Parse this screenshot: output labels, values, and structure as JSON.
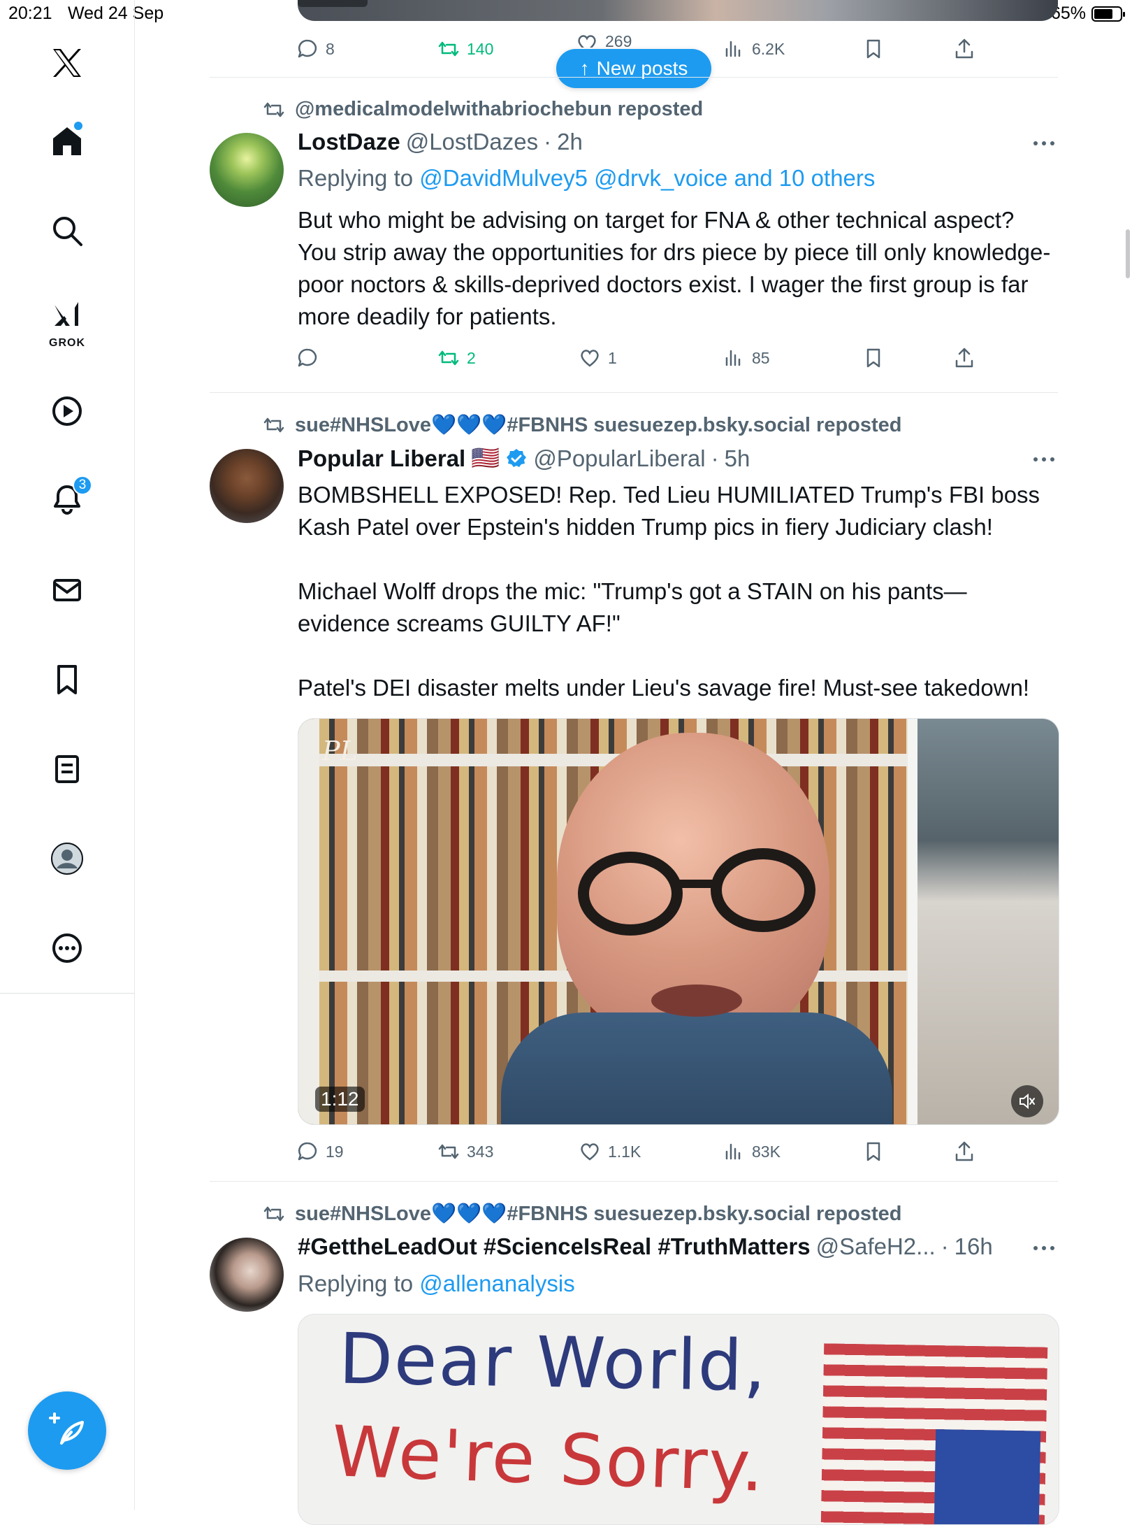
{
  "status_bar": {
    "time": "20:21",
    "date": "Wed 24 Sep",
    "battery": "65%",
    "battery_level": 0.65
  },
  "sidebar": {
    "items": [
      {
        "name": "home",
        "icon": "home-icon"
      },
      {
        "name": "search",
        "icon": "search-icon"
      },
      {
        "name": "grok",
        "icon": "grok-icon",
        "label": "GROK"
      },
      {
        "name": "videos",
        "icon": "play-icon"
      },
      {
        "name": "notifications",
        "icon": "bell-icon",
        "badge": "3"
      },
      {
        "name": "messages",
        "icon": "mail-icon"
      },
      {
        "name": "bookmarks",
        "icon": "bookmark-icon"
      },
      {
        "name": "lists",
        "icon": "list-icon"
      },
      {
        "name": "profile",
        "icon": "profile-icon"
      },
      {
        "name": "more",
        "icon": "more-icon"
      }
    ]
  },
  "new_posts_button": {
    "label": "New posts"
  },
  "top_post": {
    "replies": "8",
    "reposts": "140",
    "likes": "269",
    "views": "6.2K"
  },
  "posts": [
    {
      "reposted_by": "@medicalmodelwithabriochebun reposted",
      "name": "LostDaze",
      "handle": "@LostDazes",
      "time": "2h",
      "replying_prefix": "Replying to ",
      "replying_links": "@DavidMulvey5 @drvk_voice and 10 others",
      "text": "But who might be advising on target for FNA & other technical aspect? You strip away the opportunities for drs piece by piece till only knowledge-poor noctors & skills-deprived doctors exist. I wager the first group is far more deadily for patients.",
      "replies": "",
      "reposts": "2",
      "likes": "1",
      "views": "85"
    },
    {
      "reposted_by": "sue#NHSLove💙💙💙#FBNHS suesuezep.bsky.social reposted",
      "name": "Popular Liberal",
      "flag": "🇺🇸",
      "handle": "@PopularLiberal",
      "time": "5h",
      "text_1": "BOMBSHELL EXPOSED! Rep. Ted Lieu HUMILIATED Trump's FBI boss Kash Patel over Epstein's hidden Trump pics in fiery Judiciary clash!",
      "text_2": "Michael Wolff drops the mic: \"Trump's got a STAIN on his pants—evidence screams GUILTY AF!\"",
      "text_3": "Patel's DEI disaster melts under Lieu's savage fire! Must-see takedown!",
      "video_watermark": "PL",
      "video_duration": "1:12",
      "replies": "19",
      "reposts": "343",
      "likes": "1.1K",
      "views": "83K"
    },
    {
      "reposted_by": "sue#NHSLove💙💙💙#FBNHS suesuezep.bsky.social reposted",
      "name": "#GettheLeadOut #ScienceIsReal #TruthMatters",
      "handle": "@SafeH2...",
      "time": "16h",
      "replying_prefix": "Replying to ",
      "replying_links": "@allenanalysis",
      "image_line_1": "Dear World,",
      "image_line_2": "We're Sorry."
    }
  ],
  "colors": {
    "accent": "#1d9bf0",
    "repost_green": "#00ba7c",
    "secondary_text": "#536471"
  }
}
